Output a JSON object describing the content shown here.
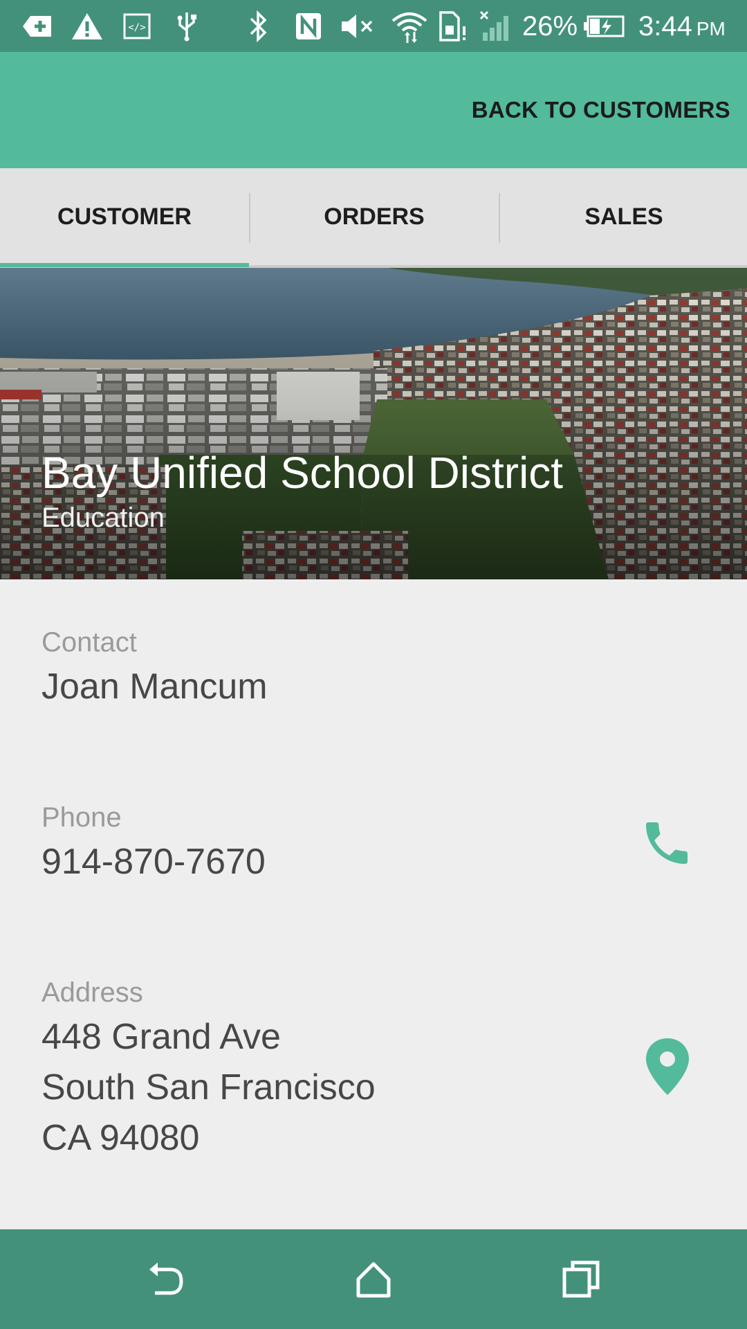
{
  "status_bar": {
    "icons": [
      "add-notification-icon",
      "warning-icon",
      "code-icon",
      "usb-icon",
      "bluetooth-icon",
      "nfc-icon",
      "mute-icon",
      "wifi-icon",
      "sim-alert-icon",
      "no-signal-icon",
      "battery-charging-icon"
    ],
    "battery_percent": "26%",
    "time": "3:44",
    "ampm": "PM"
  },
  "app_bar": {
    "back_label": "BACK TO CUSTOMERS"
  },
  "tabs": [
    {
      "label": "CUSTOMER",
      "selected": true
    },
    {
      "label": "ORDERS",
      "selected": false
    },
    {
      "label": "SALES",
      "selected": false
    }
  ],
  "hero": {
    "title": "Bay Unified School District",
    "subtitle": "Education"
  },
  "details": {
    "contact": {
      "label": "Contact",
      "value": "Joan Mancum"
    },
    "phone": {
      "label": "Phone",
      "value": "914-870-7670",
      "icon": "phone-icon"
    },
    "address": {
      "label": "Address",
      "line1": "448 Grand Ave",
      "line2": "South San Francisco",
      "line3": "CA 94080",
      "icon": "map-pin-icon"
    }
  },
  "nav_bar": {
    "icons": [
      "back-icon",
      "home-icon",
      "recents-icon"
    ]
  },
  "colors": {
    "status_bar": "#43917b",
    "app_bar": "#53ba9b",
    "accent": "#53ba9b",
    "tab_bar": "#e2e2e2",
    "background": "#eeeeee"
  }
}
